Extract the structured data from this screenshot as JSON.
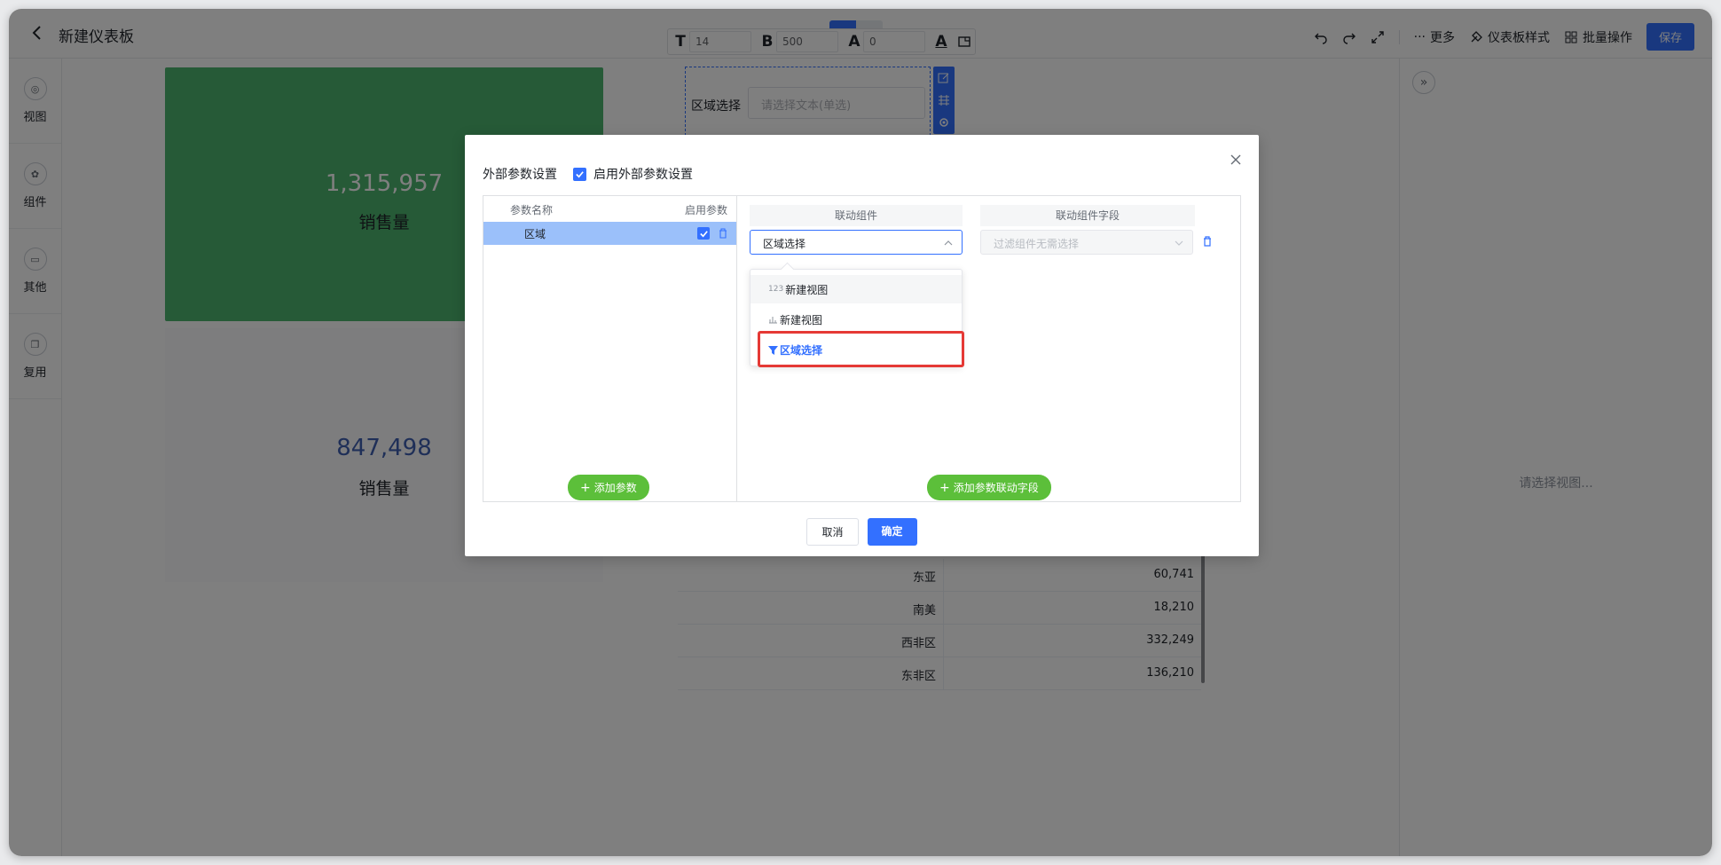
{
  "header": {
    "title": "新建仪表板",
    "format": {
      "font_size": "14",
      "font_weight": "500",
      "letter_spacing": "0"
    },
    "actions": {
      "more": "更多",
      "dashboard_style": "仪表板样式",
      "batch": "批量操作",
      "save": "保存"
    }
  },
  "rail": [
    {
      "label": "视图",
      "icon": "view-icon"
    },
    {
      "label": "组件",
      "icon": "component-icon"
    },
    {
      "label": "其他",
      "icon": "other-icon"
    },
    {
      "label": "复用",
      "icon": "reuse-icon"
    }
  ],
  "canvas": {
    "card1": {
      "value": "1,315,957",
      "label": "销售量"
    },
    "card2": {
      "value": "847,498",
      "label": "销售量"
    },
    "filter": {
      "label": "区域选择",
      "placeholder": "请选择文本(单选)"
    },
    "table_rows": [
      {
        "region": "东亚",
        "value": "60,741"
      },
      {
        "region": "南美",
        "value": "18,210"
      },
      {
        "region": "西非区",
        "value": "332,249"
      },
      {
        "region": "东非区",
        "value": "136,210"
      }
    ],
    "right_hint": "请选择视图..."
  },
  "dialog": {
    "title": "外部参数设置",
    "enable_label": "启用外部参数设置",
    "params_header": {
      "name": "参数名称",
      "enable": "启用参数"
    },
    "param_row": {
      "name": "区域"
    },
    "add_param": "添加参数",
    "linked_component_header": "联动组件",
    "linked_field_header": "联动组件字段",
    "linked_component_value": "区域选择",
    "linked_field_placeholder": "过滤组件无需选择",
    "dropdown": [
      {
        "tag": "123",
        "label": "新建视图"
      },
      {
        "tag": "bar",
        "label": "新建视图"
      },
      {
        "tag": "filter",
        "label": "区域选择"
      }
    ],
    "add_link": "添加参数联动字段",
    "cancel": "取消",
    "ok": "确定"
  },
  "colors": {
    "accent": "#3370ff",
    "green": "#4db46f",
    "button_green": "#5cbf3a",
    "highlight": "#e53935"
  }
}
